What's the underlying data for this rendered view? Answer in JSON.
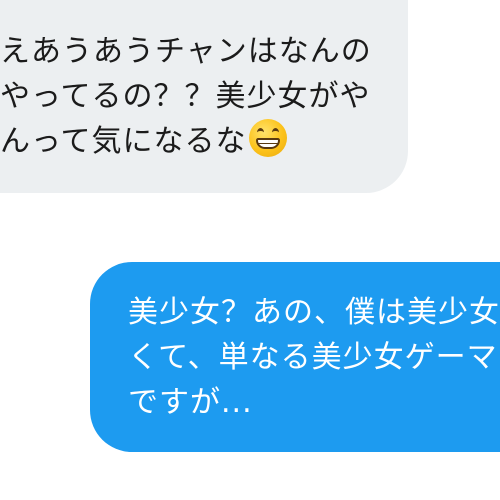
{
  "conversation": {
    "incoming_message": {
      "lines": [
        "えあうあうチャンはなんの",
        "やってるの？？美少女がや",
        "んって気になるな"
      ],
      "emoji": "grinning-face-with-smiling-eyes"
    },
    "outgoing_message": {
      "lines": [
        "美少女？あの、僕は美少女",
        "くて、単なる美少女ゲーマ",
        "ですが..."
      ]
    }
  },
  "colors": {
    "incoming_bubble": "#eceff1",
    "incoming_text": "#1b1b1b",
    "outgoing_bubble": "#1d9bf0",
    "outgoing_text": "#ffffff",
    "background": "#ffffff"
  }
}
